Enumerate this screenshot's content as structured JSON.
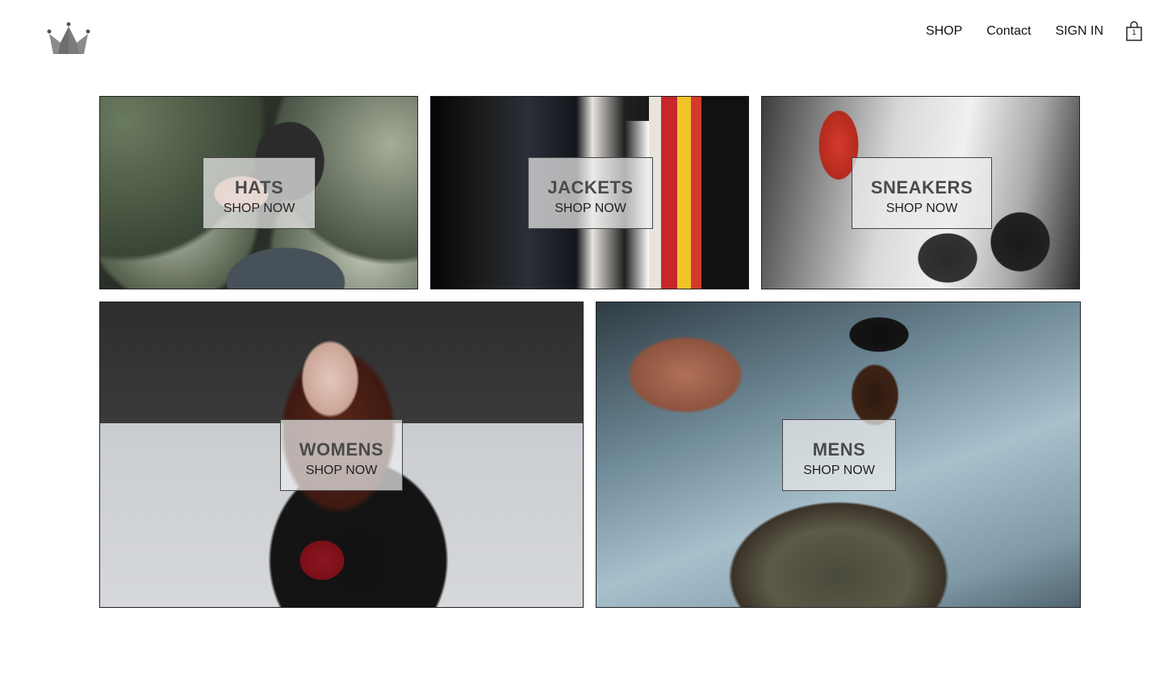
{
  "header": {
    "logo_icon": "crown-icon",
    "nav": [
      {
        "label": "SHOP"
      },
      {
        "label": "Contact"
      },
      {
        "label": "SIGN IN"
      }
    ],
    "cart": {
      "icon": "shopping-bag-icon",
      "count": "1"
    }
  },
  "categories": [
    {
      "title": "HATS",
      "cta": "SHOP NOW"
    },
    {
      "title": "JACKETS",
      "cta": "SHOP NOW"
    },
    {
      "title": "SNEAKERS",
      "cta": "SHOP NOW"
    },
    {
      "title": "WOMENS",
      "cta": "SHOP NOW"
    },
    {
      "title": "MENS",
      "cta": "SHOP NOW"
    }
  ]
}
